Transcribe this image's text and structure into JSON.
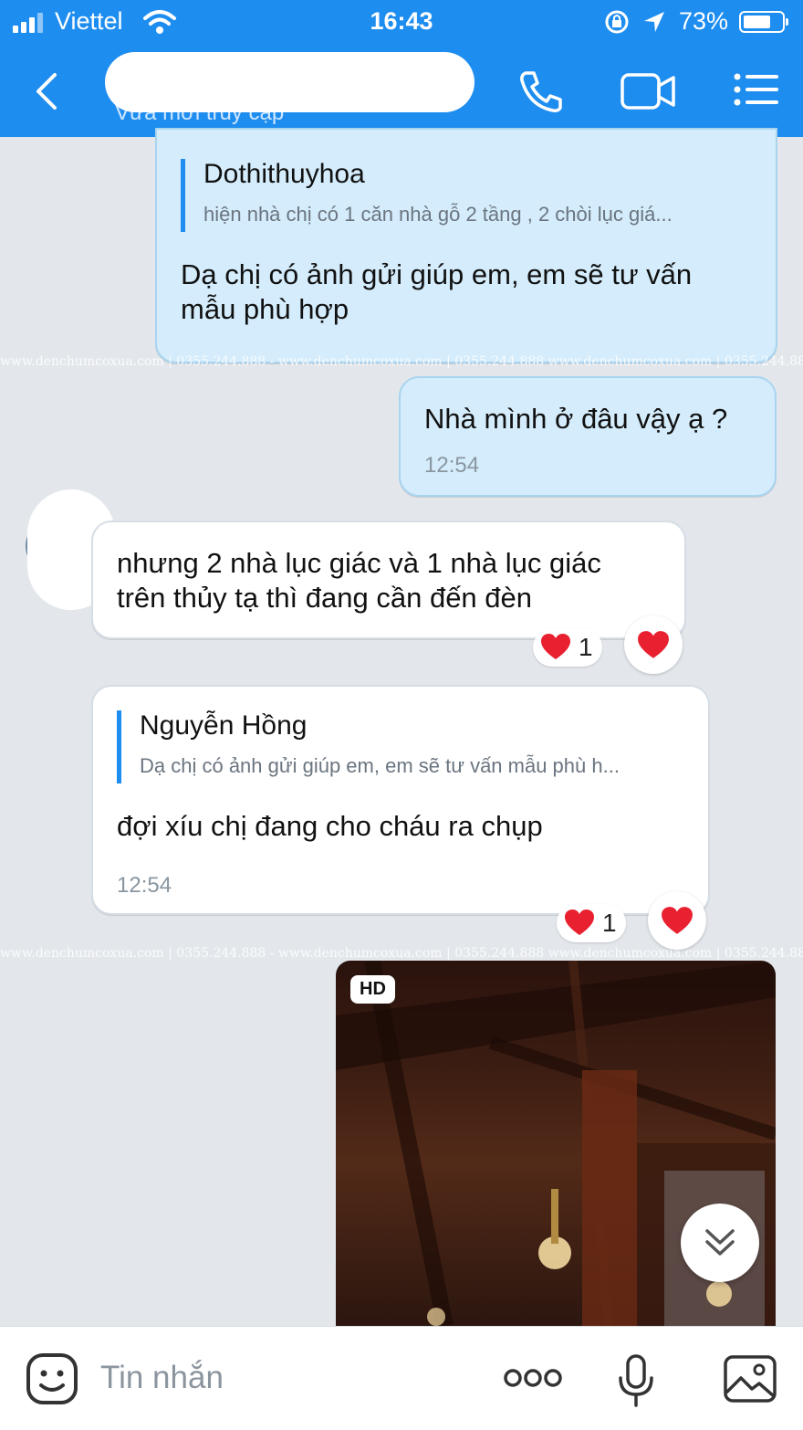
{
  "status_bar": {
    "carrier": "Viettel",
    "time": "16:43",
    "battery": "73%",
    "battery_level": 0.73
  },
  "header": {
    "subtitle": "Vừa mới truy cập"
  },
  "watermark": "www.denchumcoxua.com | 0355.244.888 - www.denchumcoxua.com | 0355.244.888 www.denchumcoxua.com | 0355.244.888",
  "messages": [
    {
      "quote_name": "Dothithuyhoa",
      "quote_text": "hiện nhà chị có 1 căn nhà gỗ 2 tầng , 2 chòi lục giá...",
      "lines": [
        "Dạ chị có ảnh gửi giúp em, em sẽ tư vấn",
        "mẫu phù hợp"
      ]
    },
    {
      "text": "Nhà mình ở đâu vậy ạ ?",
      "time": "12:54"
    },
    {
      "lines": [
        "nhưng 2 nhà lục giác và 1 nhà lục giác",
        "trên thủy tạ thì đang cần đến đèn"
      ],
      "reaction_count": "1"
    },
    {
      "quote_name": "Nguyễn Hồng",
      "quote_text": "Dạ chị có ảnh gửi giúp em, em sẽ tư vấn mẫu phù h...",
      "text": "đợi xíu chị đang cho cháu ra chụp",
      "time": "12:54",
      "reaction_count": "1"
    },
    {
      "photo_badge": "HD"
    }
  ],
  "input": {
    "placeholder": "Tin nhắn"
  },
  "colors": {
    "header": "#1e8df0",
    "sent_bubble": "#d4ecfb",
    "received_bubble": "#ffffff",
    "quote_bar": "#1e8df0",
    "heart": "#e8202f"
  },
  "icons": [
    "signal-icon",
    "wifi-icon",
    "rotation-lock-icon",
    "location-arrow-icon",
    "battery-icon",
    "back-icon",
    "phone-icon",
    "video-call-icon",
    "menu-icon",
    "heart-icon",
    "chevron-double-down-icon",
    "sticker-icon",
    "more-icon",
    "microphone-icon",
    "image-icon"
  ]
}
